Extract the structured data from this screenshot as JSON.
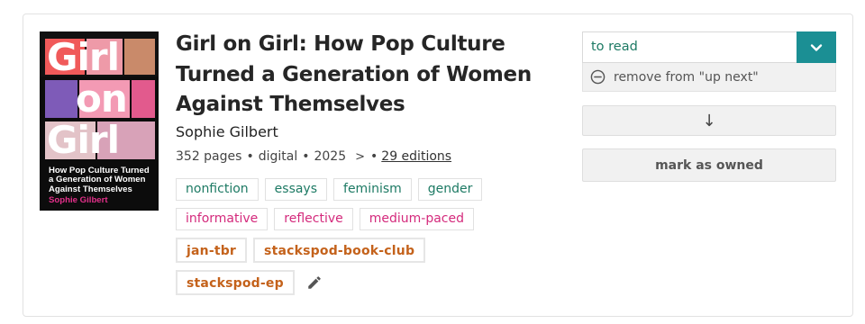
{
  "book": {
    "title": "Girl on Girl: How Pop Culture Turned a Generation of Women Against Themselves",
    "author": "Sophie Gilbert",
    "meta": {
      "pages": "352 pages",
      "sep1": "•",
      "format": "digital",
      "sep2": "•",
      "year": "2025",
      "chevron": ">",
      "sep3": "•",
      "editions": "29 editions"
    },
    "cover": {
      "word1": "Girl",
      "word2": "on",
      "word3": "Girl",
      "subtitle": "How Pop Culture Turned a Generation of Women Against Themselves",
      "author": "Sophie Gilbert"
    }
  },
  "tags": {
    "genres": [
      "nonfiction",
      "essays",
      "feminism",
      "gender"
    ],
    "moods": [
      "informative",
      "reflective",
      "medium-paced"
    ],
    "shelves_row1": [
      "jan-tbr",
      "stackspod-book-club"
    ],
    "shelves_row2": [
      "stackspod-ep"
    ]
  },
  "status": {
    "selected": "to read",
    "remove_label": "remove from \"up next\"",
    "down_arrow": "↓",
    "owned_label": "mark as owned"
  },
  "colors": {
    "genre_tag": "#1d7a64",
    "mood_tag": "#d42a7c",
    "shelf_tag": "#c4621b",
    "accent": "#1b8f94"
  },
  "icons": {
    "dropdown": "chevron-down-icon",
    "remove": "minus-circle-icon",
    "edit": "pencil-icon",
    "more": "chevron-right-icon"
  }
}
